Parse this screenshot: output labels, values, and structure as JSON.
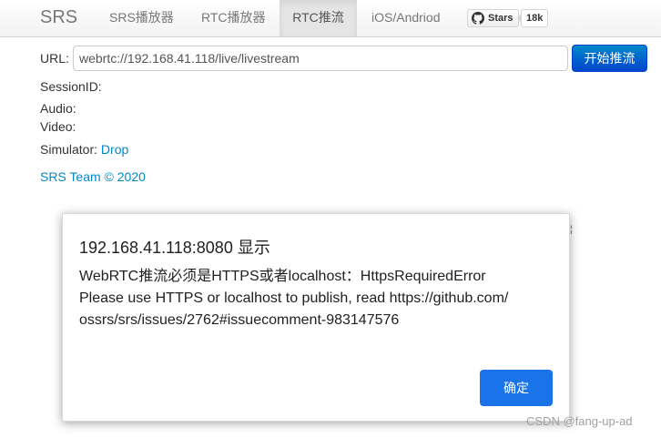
{
  "navbar": {
    "brand": "SRS",
    "items": [
      {
        "label": "SRS播放器"
      },
      {
        "label": "RTC播放器"
      },
      {
        "label": "RTC推流",
        "active": true
      },
      {
        "label": "iOS/Andriod"
      }
    ],
    "github": {
      "icon": "github-icon",
      "label": "Stars",
      "count": "18k"
    }
  },
  "form": {
    "url_label": "URL:",
    "url_value": "webrtc://192.168.41.118/live/livestream",
    "start_button": "开始推流",
    "session_label": "SessionID:",
    "audio_label": "Audio:",
    "video_label": "Video:",
    "simulator_label": "Simulator:",
    "simulator_link": "Drop",
    "footer": "SRS Team © 2020"
  },
  "dialog": {
    "title": "192.168.41.118:8080 显示",
    "message": "WebRTC推流必须是HTTPS或者localhost：HttpsRequiredError\nPlease use HTTPS or localhost to publish, read https://github.com/\nossrs/srs/issues/2762#issuecomment-983147576",
    "ok_button": "确定"
  },
  "watermark": "CSDN @fang-up-ad",
  "colors": {
    "accent": "#1a73e8",
    "primary_button": "#0055cc",
    "link": "#0088cc"
  }
}
